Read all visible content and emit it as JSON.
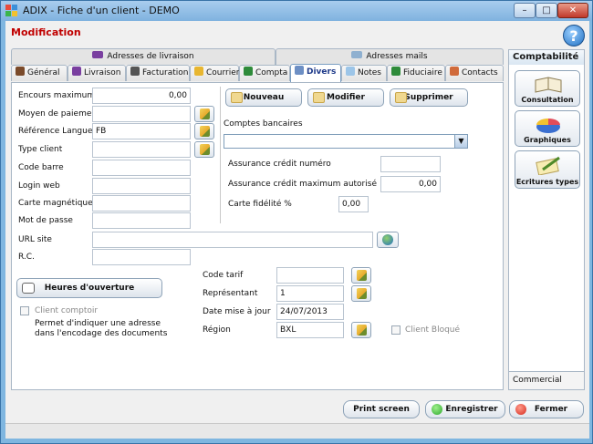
{
  "window": {
    "title": "ADIX - Fiche d'un client - DEMO"
  },
  "header": {
    "mode": "Modification",
    "help": "?"
  },
  "tabs_top": [
    "Adresses  de livraison",
    "Adresses mails"
  ],
  "tabs": [
    "Général",
    "Livraison",
    "Facturation",
    "Courrier",
    "Compta",
    "Divers",
    "Notes",
    "Fiduciaire",
    "Contacts"
  ],
  "active_tab": "Divers",
  "left_form": {
    "encours_label": "Encours maximum",
    "encours_value": "0,00",
    "moyen_label": "Moyen de paiement",
    "moyen_value": "",
    "langue_label": "Référence Langue",
    "langue_value": "FB",
    "type_label": "Type client",
    "type_value": "",
    "codebarre_label": "Code barre",
    "codebarre_value": "",
    "login_label": "Login web",
    "login_value": "",
    "carte_label": "Carte magnétique",
    "carte_value": "",
    "mdp_label": "Mot de passe",
    "mdp_value": "",
    "url_label": "URL site",
    "url_value": "",
    "rc_label": "R.C.",
    "rc_value": ""
  },
  "actions": {
    "nouveau": "Nouveau",
    "modifier": "Modifier",
    "supprimer": "Supprimer"
  },
  "bank": {
    "label": "Comptes bancaires",
    "value": "",
    "assurance_num_label": "Assurance crédit numéro",
    "assurance_num_value": "",
    "assurance_max_label": "Assurance crédit maximum autorisé",
    "assurance_max_value": "0,00",
    "fidelite_label": "Carte fidélité %",
    "fidelite_value": "0,00"
  },
  "hours": {
    "button": "Heures d'ouverture",
    "client_comptoir": "Client comptoir",
    "help": "Permet d'indiquer une adresse dans l'encodage des documents"
  },
  "bottom_form": {
    "tarif_label": "Code tarif",
    "tarif_value": "",
    "rep_label": "Représentant",
    "rep_value": "1",
    "date_label": "Date mise à jour",
    "date_value": "24/07/2013",
    "region_label": "Région",
    "region_value": "BXL",
    "bloque_label": "Client Bloqué"
  },
  "sidebar": {
    "title": "Comptabilité",
    "items": [
      "Consultation",
      "Graphiques",
      "Ecritures types"
    ],
    "commercial": "Commercial"
  },
  "footer": {
    "print": "Print screen",
    "save": "Enregistrer",
    "close": "Fermer"
  },
  "colors": {
    "accent_red": "#c00000",
    "save_green": "#2ea82e",
    "close_red": "#d62b1f"
  }
}
